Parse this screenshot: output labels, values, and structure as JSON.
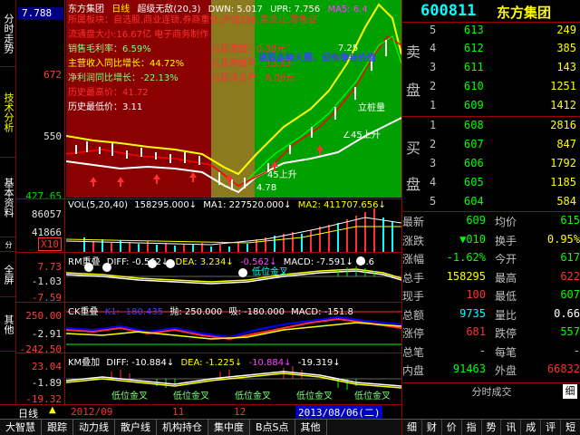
{
  "side_tabs": [
    "分时走势",
    "技术分析",
    "基本资料",
    "分时",
    "全屏",
    "其他"
  ],
  "axis": {
    "code": "7.788",
    "main": [
      "672",
      "550",
      "427.65"
    ],
    "vol": [
      "86057",
      "41866",
      "X10"
    ],
    "p2": [
      "7.73",
      "-1.03",
      "-7.59"
    ],
    "p3": [
      "250.00",
      "-2.91",
      "-242.50"
    ],
    "p4": [
      "23.04",
      "-1.89",
      "-19.32"
    ],
    "period": "日线"
  },
  "main_title": {
    "name": "东方集团",
    "period": "日线",
    "indicator": "超级无敌(20,3)",
    "dwn": "DWN: 5.017",
    "upr": "UPR: 7.756",
    "ma5": "MA5: 6.4"
  },
  "main_info": [
    {
      "text": "所属板块：自选股,商业连锁,券商重仓,沪深300,黑龙江,零售业",
      "color": "c-red"
    },
    {
      "text": "流通盘大小:16.67亿 电子商务制作",
      "color": "c-red"
    },
    {
      "text": "销售毛利率：6.59%",
      "color": "c-lgreen"
    },
    {
      "text": "主营收入同比增长：44.72%",
      "color": "c-yellow"
    },
    {
      "text": "净利润同比增长：-22.13%",
      "color": "c-lgreen"
    },
    {
      "text": "历史最高价：41.72",
      "color": "c-red"
    },
    {
      "text": "历史最低价：3.11",
      "color": "c-white"
    }
  ],
  "main_info_right": [
    {
      "text": "每股收益：0.38元",
      "color": "c-red"
    },
    {
      "text": "每股市盈率：13.93",
      "color": "c-red"
    },
    {
      "text": "每股净资产：6.06元",
      "color": "c-red"
    }
  ],
  "annotations": {
    "warn": "该股走势大弱，没有参与价值",
    "high": "7.25",
    "stand": "立桩量",
    "up45a": "∠45上升",
    "up45b": "45上升",
    "low": "4.78"
  },
  "vol_title": {
    "name": "VOL(5,20,40)",
    "v": "158295.000↓",
    "ma1": "MA1: 227520.000↓",
    "ma2": "MA2: 411707.656↓"
  },
  "p2_title": {
    "name": "RM重叠",
    "diff": "DIFF: -0.562↓",
    "dea": "DEA: 3.234↓",
    "v3": "-0.562↓",
    "macd": "MACD: -7.591↓",
    "v5": "0.6"
  },
  "p2_tag": "低位金叉",
  "p3_title": {
    "name": "CK重叠",
    "k1": "K1: -180.435",
    "d": "抛: 250.000",
    "x": "吸: -180.000",
    "macd": "MACD: -151.8"
  },
  "p4_title": {
    "name": "KM叠加",
    "diff": "DIFF: -10.884↓",
    "dea": "DEA: -1.225↓",
    "v3": "-10.884↓",
    "v4": "-19.319↓"
  },
  "p4_tags": [
    "低位金叉",
    "低位金叉",
    "低位金叉",
    "低位金叉",
    "低位金叉"
  ],
  "dates": {
    "d1": "2012/09",
    "d2": "11",
    "d3": "12",
    "cur": "2013/08/06(二)"
  },
  "bottom_tabs": [
    "大智慧",
    "跟踪",
    "动力线",
    "散户线",
    "机构持仓",
    "集中度",
    "B点S点",
    "其他"
  ],
  "stock": {
    "code": "600811",
    "name": "东方集团"
  },
  "book": {
    "sell_label_1": "卖",
    "sell_label_2": "盘",
    "buy_label_1": "买",
    "buy_label_2": "盘",
    "sell": [
      {
        "lvl": "5",
        "px": "613",
        "vol": "249"
      },
      {
        "lvl": "4",
        "px": "612",
        "vol": "385"
      },
      {
        "lvl": "3",
        "px": "611",
        "vol": "143"
      },
      {
        "lvl": "2",
        "px": "610",
        "vol": "1251"
      },
      {
        "lvl": "1",
        "px": "609",
        "vol": "1412"
      }
    ],
    "buy": [
      {
        "lvl": "1",
        "px": "608",
        "vol": "2816"
      },
      {
        "lvl": "2",
        "px": "607",
        "vol": "847"
      },
      {
        "lvl": "3",
        "px": "606",
        "vol": "1792"
      },
      {
        "lvl": "4",
        "px": "605",
        "vol": "1185"
      },
      {
        "lvl": "5",
        "px": "604",
        "vol": "584"
      }
    ]
  },
  "stats": [
    {
      "k1": "最新",
      "v1": "609",
      "c1": "#00ff00",
      "k2": "均价",
      "v2": "615",
      "c2": "#00ff00"
    },
    {
      "k1": "涨跌",
      "v1": "▼010",
      "c1": "#00ff00",
      "k2": "换手",
      "v2": "0.95%",
      "c2": "#ffff00"
    },
    {
      "k1": "涨幅",
      "v1": "-1.62%",
      "c1": "#00ff00",
      "k2": "今开",
      "v2": "617",
      "c2": "#00ff00"
    },
    {
      "k1": "总手",
      "v1": "158295",
      "c1": "#ffff00",
      "k2": "最高",
      "v2": "622",
      "c2": "#ff3030"
    },
    {
      "k1": "现手",
      "v1": "100",
      "c1": "#ff3030",
      "k2": "最低",
      "v2": "607",
      "c2": "#00ff00"
    },
    {
      "k1": "总额",
      "v1": "9735",
      "c1": "#00ffff",
      "k2": "量比",
      "v2": "0.66",
      "c2": "#ffffff"
    },
    {
      "k1": "涨停",
      "v1": "681",
      "c1": "#ff3030",
      "k2": "跌停",
      "v2": "557",
      "c2": "#00ff00"
    },
    {
      "k1": "总笔",
      "v1": "-",
      "c1": "#c0c0c0",
      "k2": "每笔",
      "v2": "-",
      "c2": "#c0c0c0"
    },
    {
      "k1": "内盘",
      "v1": "91463",
      "c1": "#00ff00",
      "k2": "外盘",
      "v2": "66832",
      "c2": "#ff3030"
    }
  ],
  "ticker_title": "分时成交",
  "fine_btn": "细",
  "quote_tabs": [
    "细",
    "财",
    "价",
    "指",
    "势",
    "讯",
    "成",
    "评",
    "短"
  ],
  "colors": {
    "up": "#ff3030",
    "down": "#00ff00",
    "accent": "#ffff00",
    "border": "#990000"
  }
}
